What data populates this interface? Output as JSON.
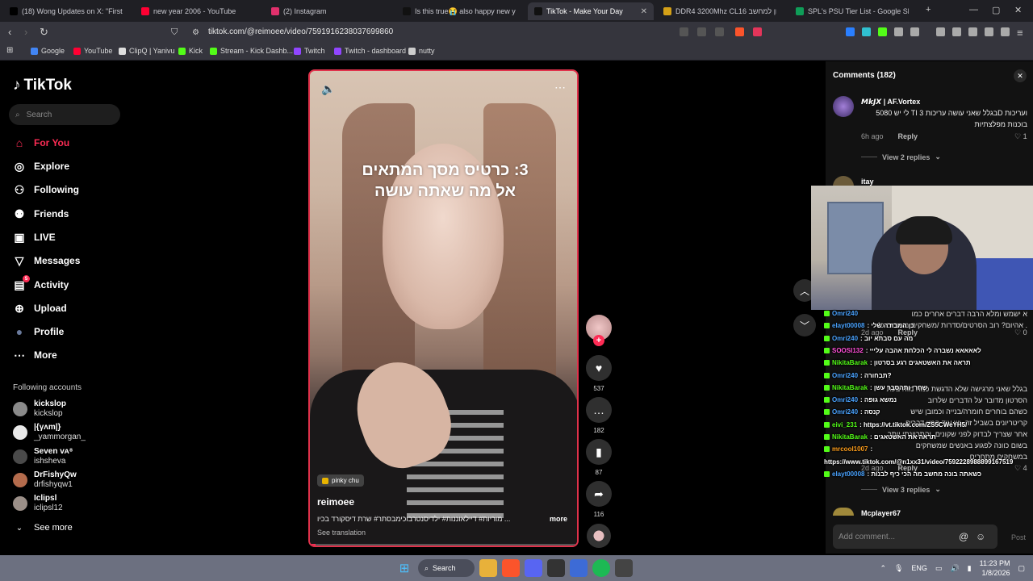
{
  "browser": {
    "tabs": [
      {
        "label": "(18) Wong Updates on X: \"First look",
        "color": "#000000",
        "active": false
      },
      {
        "label": "new year 2006 - YouTube",
        "color": "#ff0033",
        "active": false
      },
      {
        "label": "(2) Instagram",
        "color": "#e1306c",
        "active": false
      },
      {
        "label": "Is this true😭 also happy new years",
        "color": "#111111",
        "active": false
      },
      {
        "label": "TikTok - Make Your Day",
        "color": "#111111",
        "active": true
      },
      {
        "label": "DDR4 3200Mhz CL16 זיכרון למחשב",
        "color": "#d4a017",
        "active": false
      },
      {
        "label": "SPL's PSU Tier List - Google Sheets",
        "color": "#0f9d58",
        "active": false
      }
    ],
    "url": "tiktok.com/@reimoee/video/7591916238037699860",
    "bookmarks": [
      {
        "label": "Google",
        "color": "#4285f4"
      },
      {
        "label": "YouTube",
        "color": "#ff0033"
      },
      {
        "label": "ClipQ | Yanivu",
        "color": "#dddddd"
      },
      {
        "label": "Kick",
        "color": "#53fc18"
      },
      {
        "label": "Stream - Kick Dashb...",
        "color": "#53fc18"
      },
      {
        "label": "Twitch",
        "color": "#9146ff"
      },
      {
        "label": "Twitch - dashboard",
        "color": "#9146ff"
      },
      {
        "label": "nutty",
        "color": "#cccccc"
      }
    ]
  },
  "tiktok": {
    "logo": "TikTok",
    "search_placeholder": "Search",
    "nav": [
      {
        "label": "For You",
        "icon": "home-icon",
        "active": true
      },
      {
        "label": "Explore",
        "icon": "compass-icon"
      },
      {
        "label": "Following",
        "icon": "following-icon"
      },
      {
        "label": "Friends",
        "icon": "friends-icon"
      },
      {
        "label": "LIVE",
        "icon": "live-icon"
      },
      {
        "label": "Messages",
        "icon": "messages-icon"
      },
      {
        "label": "Activity",
        "icon": "activity-icon",
        "badge": "5"
      },
      {
        "label": "Upload",
        "icon": "upload-icon"
      },
      {
        "label": "Profile",
        "icon": "profile-icon"
      },
      {
        "label": "More",
        "icon": "more-icon"
      }
    ],
    "following_title": "Following accounts",
    "following": [
      {
        "name": "kickslop",
        "handle": "kickslop"
      },
      {
        "name": "|{γʌm|}",
        "handle": "_yammorgan_"
      },
      {
        "name": "Seven ᴠᴀ⁸",
        "handle": "ishsheva"
      },
      {
        "name": "DrFishyQw",
        "handle": "drfishyqw1"
      },
      {
        "name": "Iclipsl",
        "handle": "iclipsl12"
      }
    ],
    "see_more": "See more"
  },
  "video": {
    "overlay_text": "3: כרטיס מסך המתאים\nאל מה שאתה עושה",
    "sound": "pinky chu",
    "author": "reimoee",
    "caption": "... מוריות# דיילאוננות# ילדיסנטרבוכימבסתר# שרת דיסקורד בכיו",
    "more": "more",
    "see_translation": "See translation",
    "progress": 0.02
  },
  "actions": {
    "likes": "537",
    "comments": "182",
    "saves": "87",
    "shares": "116"
  },
  "comments": {
    "title": "Comments (182)",
    "items": [
      {
        "user": "𝙈𝙠𝙅𝙓 | AF.Vortex",
        "text": "ועריכות Dבגלל שאני עושה עריכות 3 TI לי יש 5080\nבוכנות מפלצתיות",
        "time": "6h ago",
        "reply": "Reply",
        "likes": "1",
        "view_replies": "View 2 replies"
      },
      {
        "user": "itay"
      }
    ],
    "partial": [
      {
        "text": "א ישמש ומלא הרבה דברים אחרים כמו\n. אהיום? רוב הסרטים/סדרות /משחקים משודים כ4",
        "time": "2d ago",
        "reply": "Reply",
        "likes": "0"
      },
      {
        "text": "בגלל שאני מרגישה שלא הדגשת כמה מוח בעת\nהסרטון מדובר על הדברים שלרוב\nכשהם בוחרים חומרה/בנייה וכמובן שיש\nקריטריונים בשביל זה, יש עוד המון דברים\nאחר שצריך לבדוק לפני שקונים, והתכוונתי יותר\nבשום כוונה לפגוע באנשים שמשחקים\nבמשחקים מתחרים",
        "time": "2d ago",
        "reply": "Reply",
        "likes": "4",
        "view_replies": "View 3 replies"
      },
      {
        "user": "Mcplayer67"
      }
    ],
    "add_placeholder": "Add comment...",
    "post": "Post"
  },
  "chat": [
    {
      "user": "Omri240",
      "msg": "",
      "color": "#4aa3ff"
    },
    {
      "user": "elayt00008",
      "msg": ": כן המבודה שלי",
      "color": "#4aa3ff"
    },
    {
      "user": "Omri240",
      "msg": ": מה עם סבתא יוב",
      "color": "#4aa3ff"
    },
    {
      "user": "SOOSI132",
      "msg": ": לאאאאא נשברה לי הכלחת אהבה עלייי",
      "color": "#ff4fd8"
    },
    {
      "user": "NikitaBarak",
      "msg": ": תראה את האשטאגים רגע בסרטון",
      "color": "#53fc18"
    },
    {
      "user": "Omri240",
      "msg": ": תבחורה?",
      "color": "#4aa3ff"
    },
    {
      "user": "NikitaBarak",
      "msg": ": שחרי ותהסבר עשן",
      "color": "#53fc18"
    },
    {
      "user": "Omri240",
      "msg": ": נמשא גופה",
      "color": "#4aa3ff"
    },
    {
      "user": "Omri240",
      "msg": ": קנסה",
      "color": "#4aa3ff"
    },
    {
      "user": "eivi_231",
      "msg": ": https://vt.tiktok.com/ZS5CWeYH5/",
      "color": "#53fc18"
    },
    {
      "user": "NikitaBarak",
      "msg": ": תראה את האשטאגים",
      "color": "#53fc18"
    },
    {
      "user": "mrcool1007",
      "msg": ":",
      "color": "#ff9f1c"
    },
    {
      "user": "",
      "msg": "https://www.tiktok.com/@n1xx31/video/7592228988899167519",
      "color": "#ffffff"
    },
    {
      "user": "elayt00008",
      "msg": ": כשאתה בונה מחשב מה הכי כיף לבנות",
      "color": "#4aa3ff"
    }
  ],
  "taskbar": {
    "search": "Search",
    "lang": "ENG",
    "time": "11:23 PM",
    "date": "1/8/2026"
  }
}
